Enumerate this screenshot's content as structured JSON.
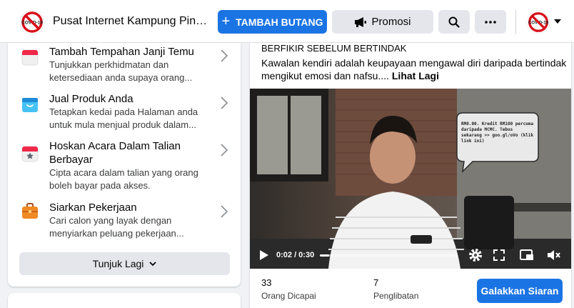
{
  "header": {
    "page_name": "Pusat Internet Kampung Pina...",
    "add_button_label": "TAMBAH BUTANG",
    "promo_button_label": "Promosi",
    "page_avatar_icon": "no-covid-logo",
    "profile_avatar_icon": "no-covid-logo",
    "avatar_logo_text": "COVID-19"
  },
  "left_menu": {
    "items": [
      {
        "icon": "calendar-icon",
        "title": "Tambah Tempahan Janji Temu",
        "desc": "Tunjukkan perkhidmatan dan ketersediaan anda supaya orang..."
      },
      {
        "icon": "shop-icon",
        "title": "Jual Produk Anda",
        "desc": "Tetapkan kedai pada Halaman anda untuk mula menjual produk dalam..."
      },
      {
        "icon": "event-star-icon",
        "title": "Hoskan Acara Dalam Talian Berbayar",
        "desc": "Cipta acara dalam talian yang orang boleh bayar pada akses."
      },
      {
        "icon": "briefcase-icon",
        "title": "Siarkan Pekerjaan",
        "desc": "Cari calon yang layak dengan menyiarkan peluang pekerjaan..."
      }
    ],
    "show_more_label": "Tunjuk Lagi"
  },
  "post": {
    "header_text": "BERFIKIR SEBELUM BERTINDAK",
    "body_text": "Kawalan kendiri adalah keupayaan mengawal diri daripada bertindak mengikut emosi dan nafsu.... ",
    "see_more_label": "Lihat Lagi",
    "video": {
      "bubble_text": "RM0.00. Kredit RM100 percuma daripada MCMC. Tebus sekarang >> goo.gl/oVo (klik link ini)",
      "timecode": "0:02 / 0:30",
      "progress": 0.067
    },
    "stats": {
      "reach_value": "33",
      "reach_label": "Orang Dicapai",
      "engagement_value": "7",
      "engagement_label": "Penglibatan"
    },
    "boost_label": "Galakkan Siaran"
  },
  "colors": {
    "brand_blue": "#1b74e4",
    "grey_button": "#e4e6eb",
    "background": "#f0f2f5"
  }
}
